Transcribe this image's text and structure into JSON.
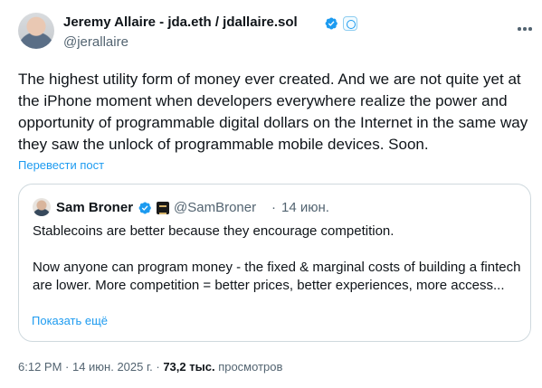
{
  "author": {
    "name": "Jeremy Allaire - jda.eth / jdallaire.sol",
    "handle": "@jerallaire",
    "verified_icon": "verified-badge-icon",
    "affiliate_icon": "affiliate-badge-icon"
  },
  "tweet": {
    "text": "The highest utility form of money ever created. And we are not quite yet at the iPhone moment when developers everywhere realize the power and opportunity of programmable digital dollars on the Internet in the same way they saw the unlock of programmable mobile devices. Soon.",
    "translate_label": "Перевести пост"
  },
  "quote": {
    "name": "Sam Broner",
    "handle": "@SamBroner",
    "separator": "·",
    "date": "14 июн.",
    "paragraph1": "Stablecoins are better because they encourage competition.",
    "paragraph2": "Now anyone can program money - the fixed & marginal costs of building a fintech are lower. More competition = better prices, better experiences, more access...",
    "show_more": "Показать ещё"
  },
  "meta": {
    "timestamp": "6:12 PM · 14 июн. 2025 г. ·",
    "views_count": "73,2 тыс.",
    "views_label": "просмотров"
  },
  "colors": {
    "accent": "#1d9bf0",
    "text": "#0f1419",
    "muted": "#536471",
    "border": "#cfd9de"
  }
}
